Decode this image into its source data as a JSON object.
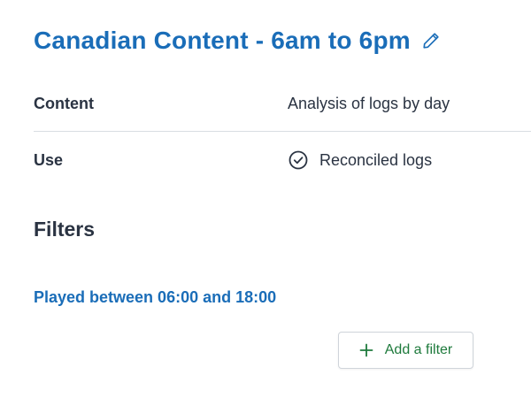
{
  "header": {
    "title": "Canadian Content - 6am to 6pm",
    "edit_icon": "pencil-icon",
    "title_color": "#1a6db8"
  },
  "details": {
    "content": {
      "label": "Content",
      "value": "Analysis of logs by day"
    },
    "use": {
      "label": "Use",
      "value": "Reconciled logs",
      "icon": "check-circle-icon"
    }
  },
  "filters": {
    "heading": "Filters",
    "items": [
      {
        "label": "Played between 06:00 and 18:00"
      }
    ],
    "add_button": {
      "label": "Add a filter",
      "icon": "plus-icon",
      "color": "#1e7a3c"
    }
  }
}
